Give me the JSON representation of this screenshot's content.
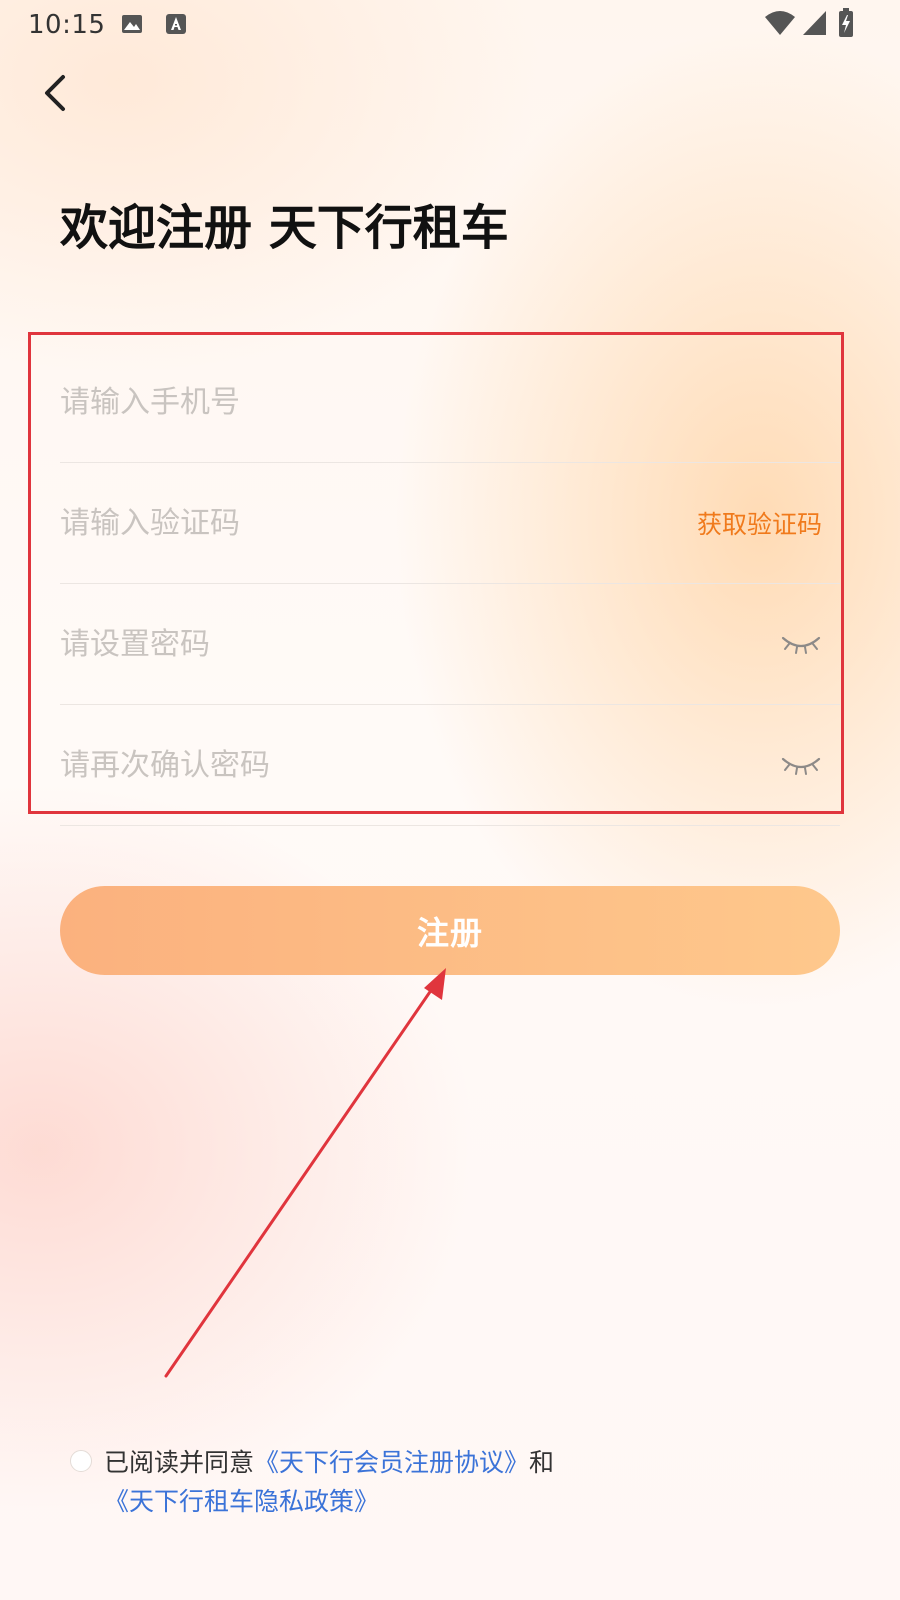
{
  "status_bar": {
    "time": "10:15",
    "icons": [
      "image-icon",
      "a-text-icon",
      "wifi-icon",
      "signal-icon",
      "battery-charging-icon"
    ]
  },
  "page": {
    "title": "欢迎注册 天下行租车"
  },
  "form": {
    "phone_placeholder": "请输入手机号",
    "code_placeholder": "请输入验证码",
    "get_code_label": "获取验证码",
    "password_placeholder": "请设置密码",
    "confirm_password_placeholder": "请再次确认密码"
  },
  "register_button": {
    "label": "注册"
  },
  "agreement": {
    "prefix": "已阅读并同意",
    "member_agreement": "《天下行会员注册协议》",
    "conjunction": "和",
    "privacy_policy": "《天下行租车隐私政策》"
  },
  "colors": {
    "accent_orange": "#f07a1c",
    "button_gradient_start": "#fbb17e",
    "button_gradient_end": "#fec88c",
    "link_blue": "#3b73d8",
    "annotation_red": "#e0353d"
  }
}
